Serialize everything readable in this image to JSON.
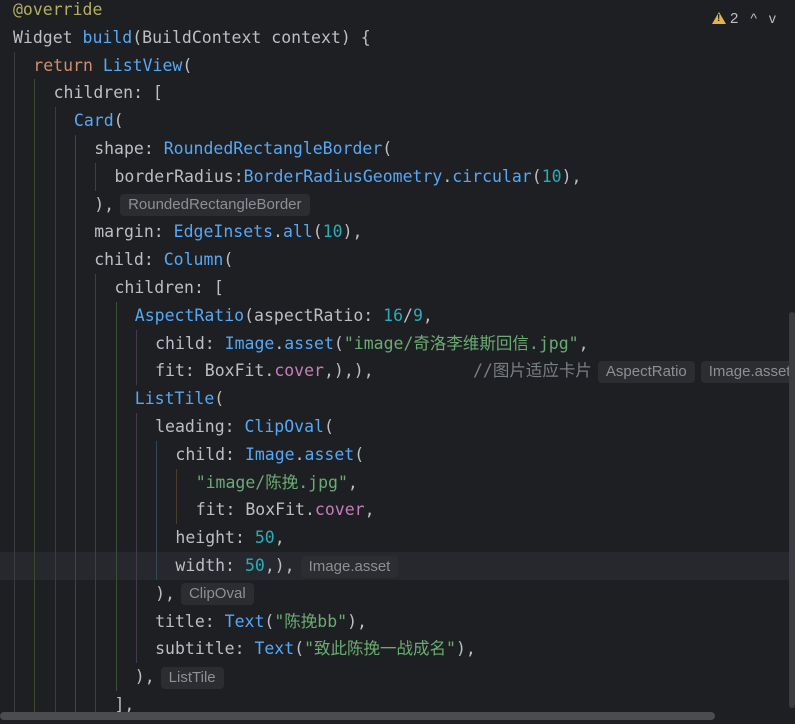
{
  "editor": {
    "warnings": {
      "count": "2",
      "up_label": "^",
      "down_label": "v"
    },
    "lines": [
      {
        "indent": 0,
        "tokens": [
          {
            "t": "annotation",
            "v": "@override"
          }
        ]
      },
      {
        "indent": 0,
        "tokens": [
          {
            "t": "plain",
            "v": "Widget "
          },
          {
            "t": "method",
            "v": "build"
          },
          {
            "t": "plain",
            "v": "(BuildContext context) {"
          }
        ]
      },
      {
        "indent": 1,
        "tokens": [
          {
            "t": "keyword",
            "v": "return "
          },
          {
            "t": "class",
            "v": "ListView"
          },
          {
            "t": "plain",
            "v": "("
          }
        ]
      },
      {
        "indent": 2,
        "tokens": [
          {
            "t": "plain",
            "v": "children: ["
          }
        ]
      },
      {
        "indent": 3,
        "tokens": [
          {
            "t": "class",
            "v": "Card"
          },
          {
            "t": "plain",
            "v": "("
          }
        ]
      },
      {
        "indent": 4,
        "tokens": [
          {
            "t": "plain",
            "v": "shape: "
          },
          {
            "t": "class",
            "v": "RoundedRectangleBorder"
          },
          {
            "t": "plain",
            "v": "("
          }
        ]
      },
      {
        "indent": 5,
        "tokens": [
          {
            "t": "plain",
            "v": "borderRadius:"
          },
          {
            "t": "class",
            "v": "BorderRadiusGeometry"
          },
          {
            "t": "plain",
            "v": "."
          },
          {
            "t": "func",
            "v": "circular"
          },
          {
            "t": "plain",
            "v": "("
          },
          {
            "t": "number",
            "v": "10"
          },
          {
            "t": "plain",
            "v": "),"
          }
        ]
      },
      {
        "indent": 4,
        "tokens": [
          {
            "t": "plain",
            "v": "),"
          }
        ],
        "hints": [
          "RoundedRectangleBorder"
        ]
      },
      {
        "indent": 4,
        "tokens": [
          {
            "t": "plain",
            "v": "margin: "
          },
          {
            "t": "class",
            "v": "EdgeInsets"
          },
          {
            "t": "plain",
            "v": "."
          },
          {
            "t": "func",
            "v": "all"
          },
          {
            "t": "plain",
            "v": "("
          },
          {
            "t": "number",
            "v": "10"
          },
          {
            "t": "plain",
            "v": "),"
          }
        ]
      },
      {
        "indent": 4,
        "tokens": [
          {
            "t": "plain",
            "v": "child: "
          },
          {
            "t": "class",
            "v": "Column"
          },
          {
            "t": "plain",
            "v": "("
          }
        ]
      },
      {
        "indent": 5,
        "tokens": [
          {
            "t": "plain",
            "v": "children: ["
          }
        ]
      },
      {
        "indent": 6,
        "tokens": [
          {
            "t": "class",
            "v": "AspectRatio"
          },
          {
            "t": "plain",
            "v": "(aspectRatio: "
          },
          {
            "t": "number",
            "v": "16"
          },
          {
            "t": "plain",
            "v": "/"
          },
          {
            "t": "number",
            "v": "9"
          },
          {
            "t": "plain",
            "v": ","
          }
        ]
      },
      {
        "indent": 7,
        "tokens": [
          {
            "t": "plain",
            "v": "child: "
          },
          {
            "t": "class",
            "v": "Image"
          },
          {
            "t": "plain",
            "v": "."
          },
          {
            "t": "func",
            "v": "asset"
          },
          {
            "t": "plain",
            "v": "("
          },
          {
            "t": "string",
            "v": "\"image/奇洛李维斯回信.jpg\""
          },
          {
            "t": "plain",
            "v": ","
          }
        ]
      },
      {
        "indent": 7,
        "tokens": [
          {
            "t": "plain",
            "v": "fit: BoxFit."
          },
          {
            "t": "field",
            "v": "cover"
          },
          {
            "t": "plain",
            "v": ",),),"
          },
          {
            "t": "plain",
            "v": "          "
          },
          {
            "t": "comment",
            "v": "//图片适应卡片"
          }
        ],
        "hints": [
          "AspectRatio",
          "Image.asset"
        ]
      },
      {
        "indent": 6,
        "tokens": [
          {
            "t": "class",
            "v": "ListTile"
          },
          {
            "t": "plain",
            "v": "("
          }
        ]
      },
      {
        "indent": 7,
        "tokens": [
          {
            "t": "plain",
            "v": "leading: "
          },
          {
            "t": "class",
            "v": "ClipOval"
          },
          {
            "t": "plain",
            "v": "("
          }
        ]
      },
      {
        "indent": 8,
        "tokens": [
          {
            "t": "plain",
            "v": "child: "
          },
          {
            "t": "class",
            "v": "Image"
          },
          {
            "t": "plain",
            "v": "."
          },
          {
            "t": "func",
            "v": "asset"
          },
          {
            "t": "plain",
            "v": "("
          }
        ]
      },
      {
        "indent": 9,
        "tokens": [
          {
            "t": "string",
            "v": "\"image/陈挽.jpg\""
          },
          {
            "t": "plain",
            "v": ","
          }
        ]
      },
      {
        "indent": 9,
        "tokens": [
          {
            "t": "plain",
            "v": "fit: BoxFit."
          },
          {
            "t": "field",
            "v": "cover"
          },
          {
            "t": "plain",
            "v": ","
          }
        ]
      },
      {
        "indent": 8,
        "tokens": [
          {
            "t": "plain",
            "v": "height: "
          },
          {
            "t": "number",
            "v": "50"
          },
          {
            "t": "plain",
            "v": ","
          }
        ]
      },
      {
        "indent": 8,
        "tokens": [
          {
            "t": "plain",
            "v": "width: "
          },
          {
            "t": "number",
            "v": "50"
          },
          {
            "t": "plain",
            "v": ",),"
          }
        ],
        "hints": [
          "Image.asset"
        ],
        "current": true
      },
      {
        "indent": 7,
        "tokens": [
          {
            "t": "plain",
            "v": "),"
          }
        ],
        "hints": [
          "ClipOval"
        ]
      },
      {
        "indent": 7,
        "tokens": [
          {
            "t": "plain",
            "v": "title: "
          },
          {
            "t": "class",
            "v": "Text"
          },
          {
            "t": "plain",
            "v": "("
          },
          {
            "t": "string",
            "v": "\"陈挽bb\""
          },
          {
            "t": "plain",
            "v": "),"
          }
        ]
      },
      {
        "indent": 7,
        "tokens": [
          {
            "t": "plain",
            "v": "subtitle: "
          },
          {
            "t": "class",
            "v": "Text"
          },
          {
            "t": "plain",
            "v": "("
          },
          {
            "t": "string",
            "v": "\"致此陈挽一战成名\""
          },
          {
            "t": "plain",
            "v": "),"
          }
        ]
      },
      {
        "indent": 6,
        "tokens": [
          {
            "t": "plain",
            "v": "),"
          }
        ],
        "hints": [
          "ListTile"
        ]
      },
      {
        "indent": 5,
        "tokens": [
          {
            "t": "plain",
            "v": "],"
          }
        ]
      }
    ]
  },
  "colors": {
    "background": "#1e1f22",
    "guides": [
      "#3a3c3f",
      "#3d4a2e",
      "#3b3a4f",
      "#2f4a57",
      "#4a3f2f",
      "#3b4d3b",
      "#443a52",
      "#2f4a57",
      "#4a3f2f",
      "#3b4d3b"
    ]
  }
}
